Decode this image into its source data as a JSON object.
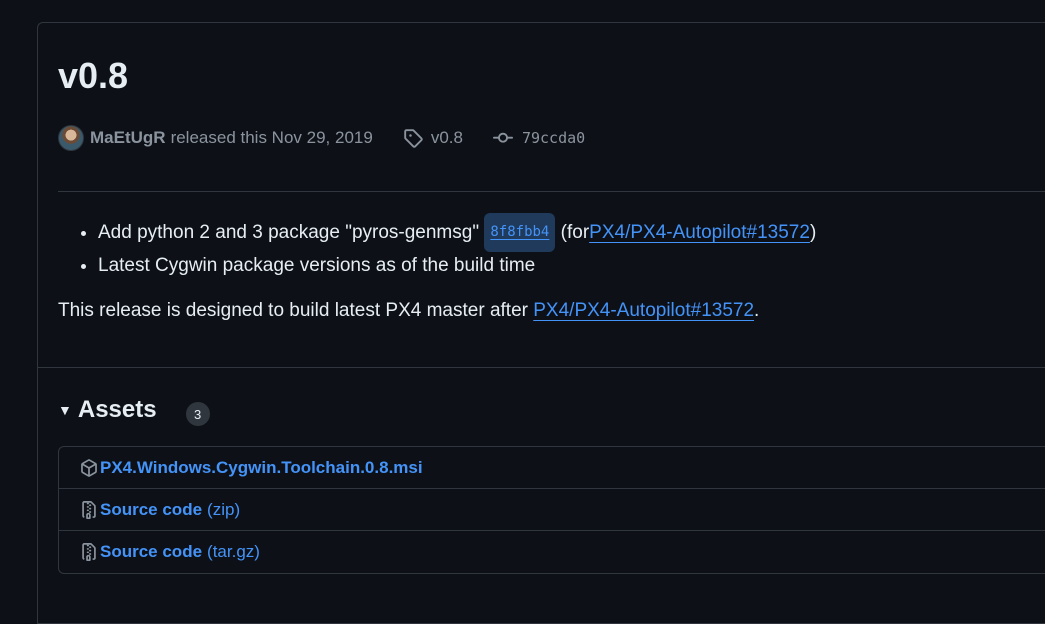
{
  "release": {
    "title": "v0.8",
    "author": "MaEtUgR",
    "released_text": "released this Nov 29, 2019",
    "tag": "v0.8",
    "commit": "79ccda0"
  },
  "notes": {
    "items": [
      {
        "text_before": "Add python 2 and 3 package \"pyros-genmsg\"",
        "sha": "8f8fbb4",
        "text_mid": "(for",
        "link": "PX4/PX4-Autopilot#13572",
        "text_after": ")"
      },
      {
        "text": "Latest Cygwin package versions as of the build time"
      }
    ],
    "paragraph_before": "This release is designed to build latest PX4 master after",
    "paragraph_link": "PX4/PX4-Autopilot#13572",
    "paragraph_after": "."
  },
  "assets": {
    "title": "Assets",
    "count": "3",
    "items": [
      {
        "name": "PX4.Windows.Cygwin.Toolchain.0.8.msi",
        "ext": "",
        "icon": "package-icon"
      },
      {
        "name": "Source code",
        "ext": "(zip)",
        "icon": "file-zip-icon"
      },
      {
        "name": "Source code",
        "ext": "(tar.gz)",
        "icon": "file-zip-icon"
      }
    ]
  },
  "colors": {
    "background": "#0d1117",
    "link": "#4493f8",
    "muted": "#8b949e",
    "border": "#30363d"
  }
}
